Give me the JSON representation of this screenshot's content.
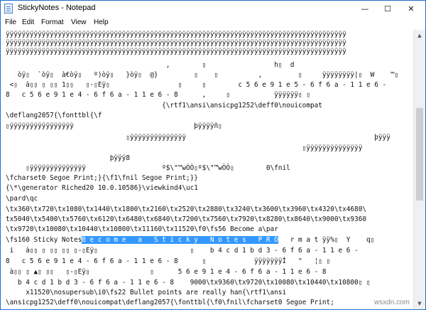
{
  "window": {
    "title": "StickyNotes - Notepad",
    "min_icon": "—",
    "max_icon": "☐",
    "close_icon": "✕"
  },
  "menu": [
    "File",
    "Edit",
    "Format",
    "View",
    "Help"
  ],
  "editor": {
    "lines": [
      "ÿÿÿÿÿÿÿÿÿÿÿÿÿÿÿÿÿÿÿÿÿÿÿÿÿÿÿÿÿÿÿÿÿÿÿÿÿÿÿÿÿÿÿÿÿÿÿÿÿÿÿÿÿÿÿÿÿÿÿÿÿÿÿÿÿÿÿÿÿÿÿÿÿÿÿÿÿÿÿÿÿÿÿÿÿ",
      "ÿÿÿÿÿÿÿÿÿÿÿÿÿÿÿÿÿÿÿÿÿÿÿÿÿÿÿÿÿÿÿÿÿÿÿÿÿÿÿÿÿÿÿÿÿÿÿÿÿÿÿÿÿÿÿÿÿÿÿÿÿÿÿÿÿÿÿÿÿÿÿÿÿÿÿÿÿÿÿÿÿÿÿÿÿ",
      "ÿÿÿÿÿÿÿÿÿÿÿÿÿÿÿÿÿÿÿÿÿÿÿÿÿÿÿÿÿÿÿÿÿÿÿÿÿÿÿÿÿÿÿÿÿÿÿÿÿÿÿÿÿÿÿÿÿÿÿÿÿÿÿÿÿÿÿÿÿÿÿÿÿÿÿÿÿÿÿÿÿÿÿÿÿ",
      "                                        ,        ▯                 h▯  d",
      "   òÿ▯  `òÿ▯  à€òÿ▯   º)òÿ▯   }òÿ▯  @}         ▯    ▯          ,         ▯     ÿÿÿÿÿÿÿÿ|▯  W    ™▯",
      " <▯  à▯▯ ▯ ▯▯ 1▯▯   ▯-▯Eÿ▯                 ▯     ▯        c 5 6 e 9 1 e 5 - 6 f 6 a - 1 1 e 6 -",
      "8   c 5 6 e 9 1 e 4 - 6 f 6 a - 1 1 e 6 - 8      ,     ▯           ÿÿÿÿÿÿ▯ ▯",
      "                                       {\\rtf1\\ansi\\ansicpg1252\\deff0\\nouicompat",
      "\\deflang2057{\\fonttbl{\\f",
      "▯ÿÿÿÿÿÿÿÿÿÿÿÿÿÿÿÿ                              þÿÿÿÿñ▯",
      "                              ▯ÿÿÿÿÿÿÿÿÿÿÿÿÿÿ                                               þÿÿÿ",
      "                                                                          ▯ÿÿÿÿÿÿÿÿÿÿÿÿÿÿ",
      "                          þÿÿÿ8",
      "     ▯ÿÿÿÿÿÿÿÿÿÿÿÿÿÿ                   º$\\\"™wÒÒ▯º$\\\"™wÒÒ▯        0\\fnil",
      "\\fcharset0 Segoe Print;}{\\f1\\fnil Segoe Print;}}",
      "{\\*\\generator Riched20 10.0.10586}\\viewkind4\\uc1",
      "\\pard\\qc",
      "\\tx360\\tx720\\tx1080\\tx1440\\tx1800\\tx2160\\tx2520\\tx2880\\tx3240\\tx3600\\tx3960\\tx4320\\tx4680\\",
      "tx5040\\tx5400\\tx5760\\tx6120\\tx6480\\tx6840\\tx7200\\tx7560\\tx7920\\tx8280\\tx8640\\tx9000\\tx9360",
      "\\tx9720\\tx10080\\tx10440\\tx10800\\tx11160\\tx11520\\f0\\fs56 Become a\\par"
    ],
    "sel_line": {
      "before": "\\fs160 Sticky Notes",
      "selected": "B e c o m e   a   S t i c k y   N o t e s   P R O",
      "after": "   r m a t ÿÿ%▯  Y    q▯"
    },
    "lines2": [
      " i   à▯▯ ▯ ▯▯ ▯▯ ▯-▯Eÿ▯                       ▯    b 4 c d 1 b d 3 - 6 f 6 a - 1 1 e 6 -",
      "8   c 5 6 e 9 1 e 4 - 6 f 6 a - 1 1 e 6 - 8      ▯            ÿÿÿÿÿÿÿÍ   \"   ¦▯ ▯",
      " à▯▯ ▯ ▲▯ ▯▯   ▯-▯Eÿ▯               ▯      5 6 e 9 1 e 4 - 6 f 6 a - 1 1 e 6 - 8",
      "   b 4 c d 1 b d 3 - 6 f 6 a - 1 1 e 6 - 8    9000\\tx9360\\tx9720\\tx10080\\tx10440\\tx10800▯ ▯",
      "     x11520\\nosupersub\\i0\\fs22 Bullet points are really han{\\rtf1\\ansi",
      "\\ansicpg1252\\deff0\\nouicompat\\deflang2057{\\fonttbl{\\f0\\fnil\\fcharset0 Segoe Print;"
    ]
  },
  "watermark": "wsxdn.com"
}
